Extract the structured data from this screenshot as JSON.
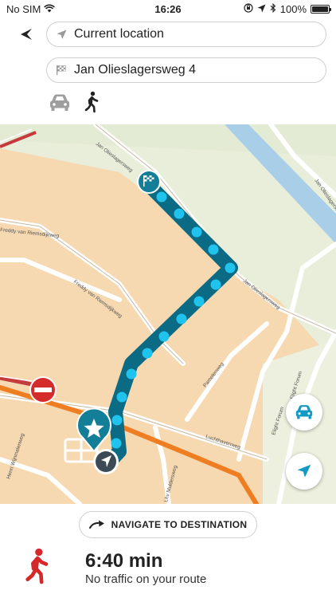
{
  "status_bar": {
    "carrier": "No SIM",
    "time": "16:26",
    "battery": "100%",
    "icons": [
      "wifi-icon",
      "orientation-lock-icon",
      "location-arrow-icon",
      "bluetooth-icon",
      "battery-icon"
    ]
  },
  "route_form": {
    "from_value": "Current location",
    "to_value": "Jan Olieslagersweg 4",
    "icons": [
      "back-arrow-icon",
      "location-arrow-icon",
      "checkered-flag-icon",
      "car-icon",
      "walking-person-icon"
    ]
  },
  "map": {
    "street_labels": [
      "Jan Olieslagersweg",
      "Jan Olieslagersweg",
      "Freddy van Riemsdijkweg",
      "Pamelenweg",
      "Luchthavenweg",
      "Elight Forum",
      "Flight Forum",
      "Lhv Muldersweg",
      "Henri Wijnmalenweg",
      "Freddy van Riemsdijkweg",
      "Jan Olieslagersweg"
    ],
    "colors": {
      "land": "#f6d8b1",
      "park": "#e9eedb",
      "water": "#a9cfe8",
      "route": "#0b6b84",
      "route_dots": "#20c3ee",
      "highway": "#ef7d22"
    },
    "icons": [
      "destination-flag-marker",
      "favorite-star-marker",
      "current-position-marker",
      "no-entry-icon"
    ]
  },
  "map_controls": {
    "icons": [
      "car-icon",
      "location-arrow-icon"
    ]
  },
  "bottom": {
    "navigate_label": "NAVIGATE TO DESTINATION",
    "eta": "6:40 min",
    "traffic": "No traffic on your route",
    "icons": [
      "arrow-right-icon",
      "walking-person-icon"
    ]
  }
}
